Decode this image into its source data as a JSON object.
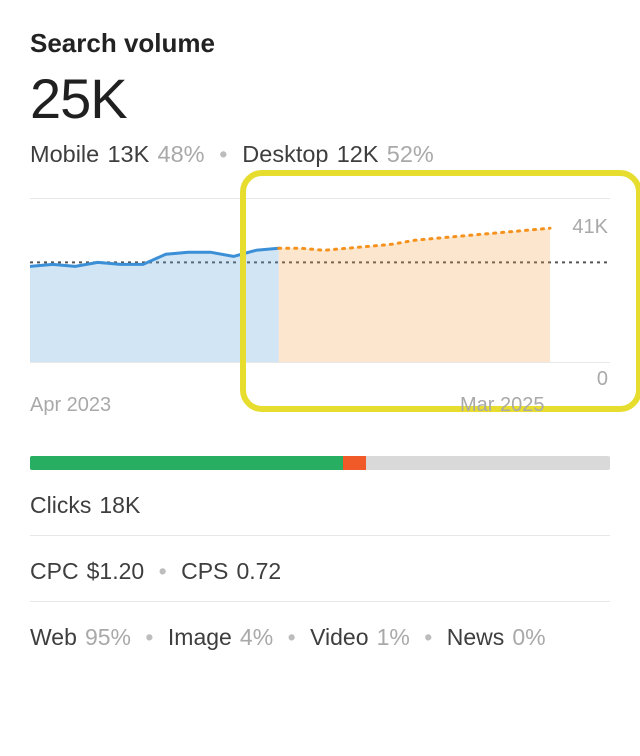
{
  "title": "Search volume",
  "total_volume": "25K",
  "device_split": {
    "mobile": {
      "label": "Mobile",
      "value": "13K",
      "pct": "48%"
    },
    "desktop": {
      "label": "Desktop",
      "value": "12K",
      "pct": "52%"
    }
  },
  "chart_data": {
    "type": "area",
    "ylim": [
      0,
      41000
    ],
    "ylabel_max": "41K",
    "ylabel_min": "0",
    "reference_value": 25000,
    "x_start_label": "Apr 2023",
    "x_end_label": "Mar 2025",
    "series": [
      {
        "name": "historical",
        "color": "#3b8fd6",
        "style": "solid",
        "x": [
          0,
          1,
          2,
          3,
          4,
          5,
          6,
          7,
          8,
          9,
          10,
          11
        ],
        "values": [
          24000,
          24500,
          24000,
          25000,
          24500,
          24500,
          27000,
          27500,
          27500,
          26500,
          28000,
          28500
        ]
      },
      {
        "name": "forecast",
        "color": "#f5921d",
        "style": "dotted",
        "x": [
          11,
          12,
          13,
          14,
          15,
          16,
          17,
          18,
          19,
          20,
          21,
          22,
          23
        ],
        "values": [
          28500,
          28500,
          28000,
          28500,
          29000,
          29500,
          30500,
          31000,
          31500,
          32000,
          32500,
          33000,
          33500
        ]
      }
    ],
    "highlight_x_range": [
      11,
      23
    ],
    "annotation": "Forecast region highlighted"
  },
  "progress": {
    "green_pct": 54,
    "orange_pct": 4
  },
  "clicks": {
    "label": "Clicks",
    "value": "18K"
  },
  "cpc": {
    "label": "CPC",
    "value": "$1.20"
  },
  "cps": {
    "label": "CPS",
    "value": "0.72"
  },
  "traffic_split": {
    "web": {
      "label": "Web",
      "pct": "95%"
    },
    "image": {
      "label": "Image",
      "pct": "4%"
    },
    "video": {
      "label": "Video",
      "pct": "1%"
    },
    "news": {
      "label": "News",
      "pct": "0%"
    }
  }
}
